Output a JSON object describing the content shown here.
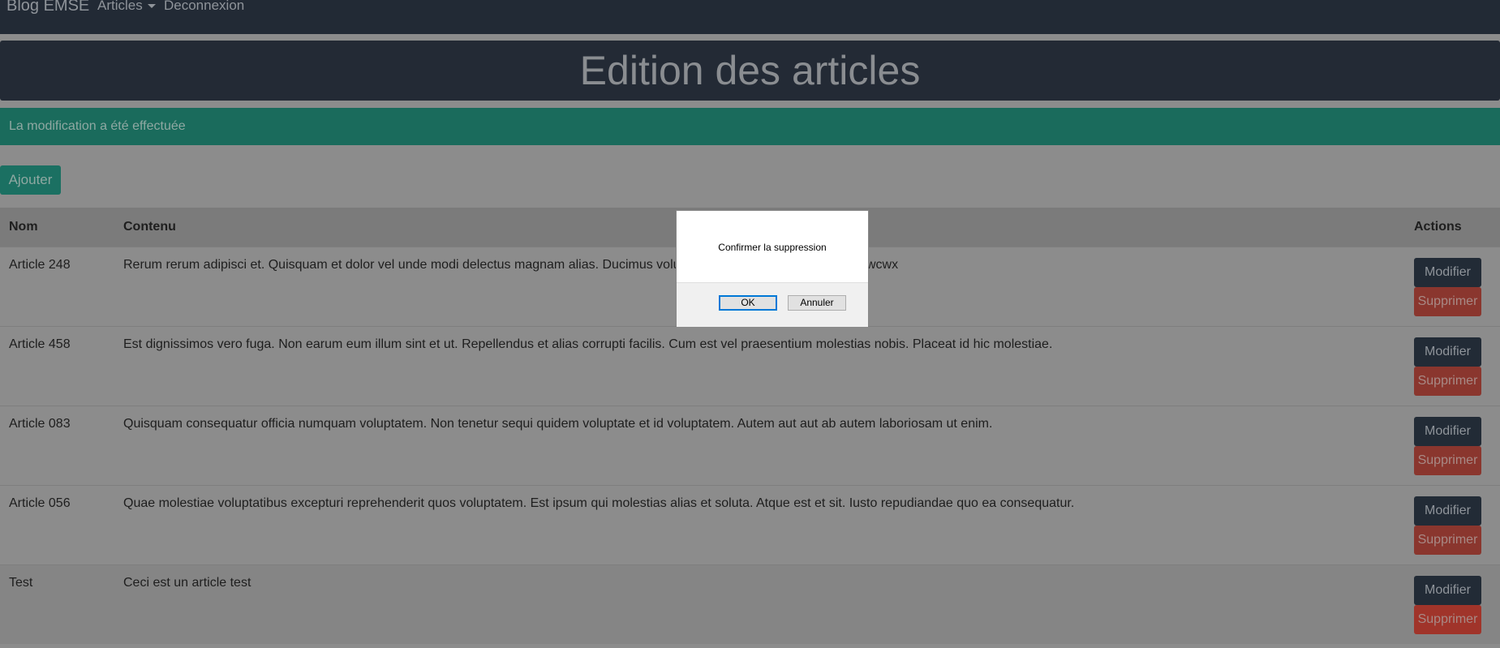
{
  "navbar": {
    "brand": "Blog EMSE",
    "articles": "Articles",
    "logout": "Deconnexion"
  },
  "header": {
    "title": "Edition des articles"
  },
  "alert": {
    "text": "La modification a été effectuée"
  },
  "add_button": "Ajouter",
  "table": {
    "columns": [
      "Nom",
      "Contenu",
      "Actions"
    ],
    "rows": [
      {
        "name": "Article 248",
        "content": "Rerum rerum adipisci et. Quisquam et dolor vel unde modi delectus magnam alias. Ducimus voluptatem fa",
        "content_tail": "wcwx"
      },
      {
        "name": "Article 458",
        "content": "Est dignissimos vero fuga. Non earum eum illum sint et ut. Repellendus et alias corrupti facilis. Cum est vel praesentium molestias nobis. Placeat id hic molestiae."
      },
      {
        "name": "Article 083",
        "content": "Quisquam consequatur officia numquam voluptatem. Non tenetur sequi quidem voluptate et id voluptatem. Autem aut aut ab autem laboriosam ut enim."
      },
      {
        "name": "Article 056",
        "content": "Quae molestiae voluptatibus excepturi reprehenderit quos voluptatem. Est ipsum qui molestias alias et soluta. Atque est et sit. Iusto repudiandae quo ea consequatur."
      },
      {
        "name": "Test",
        "content": "Ceci est un article test"
      }
    ],
    "edit_label": "Modifier",
    "delete_label": "Supprimer"
  },
  "dialog": {
    "message": "Confirmer la suppression",
    "ok": "OK",
    "cancel": "Annuler"
  }
}
